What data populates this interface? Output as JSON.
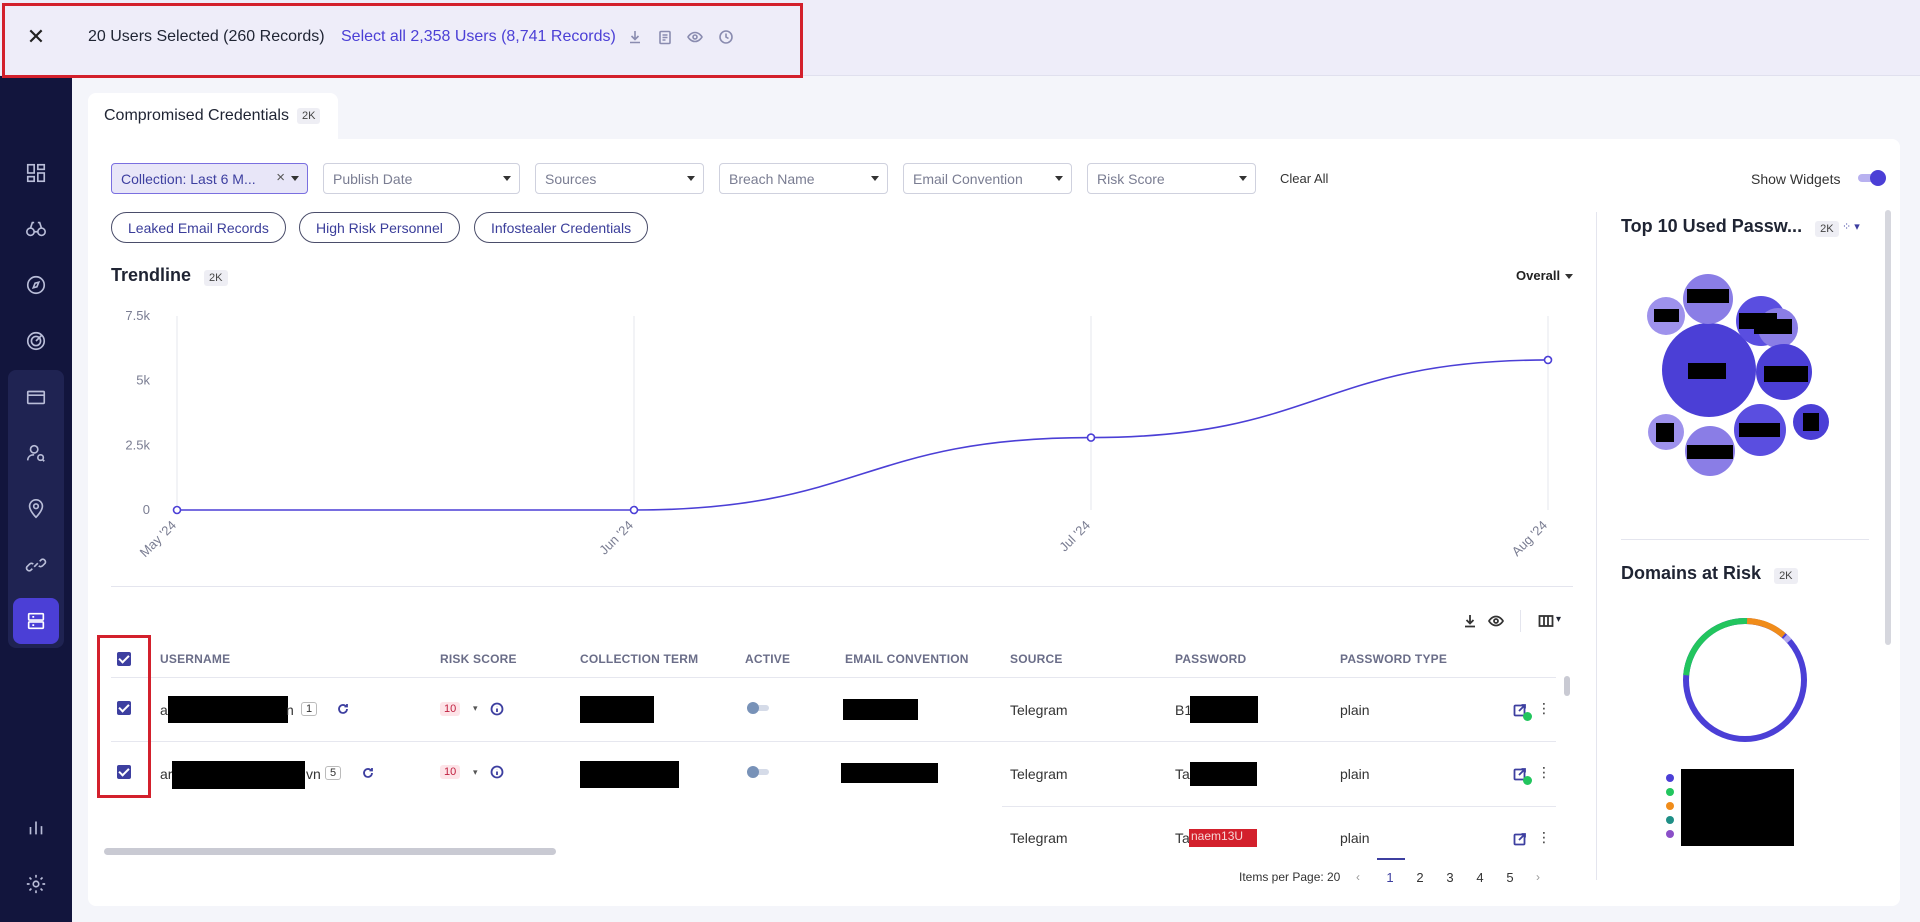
{
  "selection_bar": {
    "selected_text": "20 Users Selected (260 Records)",
    "select_all_text": "Select all 2,358 Users (8,741 Records)",
    "icons": [
      "download-icon",
      "clipboard-icon",
      "eye-icon",
      "clock-icon"
    ]
  },
  "sidebar": {
    "items": [
      "dashboard-icon",
      "binoculars-icon",
      "compass-icon",
      "radar-icon",
      "card-icon",
      "user-search-icon",
      "location-icon",
      "link-icon",
      "database-icon"
    ],
    "bottom": [
      "bar-chart-icon",
      "gear-icon"
    ]
  },
  "tab": {
    "label": "Compromised Credentials",
    "badge": "2K"
  },
  "filters": {
    "collection": "Collection: Last 6 M...",
    "publish_date": "Publish Date",
    "sources": "Sources",
    "breach_name": "Breach Name",
    "email_convention": "Email Convention",
    "risk_score": "Risk Score",
    "clear_all": "Clear All",
    "show_widgets": "Show Widgets"
  },
  "quick_filters": [
    "Leaked Email Records",
    "High Risk Personnel",
    "Infostealer Credentials"
  ],
  "trendline": {
    "title": "Trendline",
    "badge": "2K",
    "overall": "Overall"
  },
  "chart_data": {
    "type": "line",
    "title": "Trendline",
    "categories": [
      "May '24",
      "Jun '24",
      "Jul '24",
      "Aug '24"
    ],
    "values": [
      0,
      0,
      2800,
      5800
    ],
    "y_ticks": [
      "7.5k",
      "5k",
      "2.5k",
      "0"
    ],
    "ylim": [
      0,
      7500
    ],
    "grid": "vertical",
    "color": "#4b3fd6"
  },
  "top_passwords": {
    "title": "Top 10 Used Passw...",
    "badge": "2K"
  },
  "domains": {
    "title": "Domains at Risk",
    "badge": "2K"
  },
  "table": {
    "headers": [
      "USERNAME",
      "RISK SCORE",
      "COLLECTION TERM",
      "ACTIVE",
      "EMAIL CONVENTION",
      "SOURCE",
      "PASSWORD",
      "PASSWORD TYPE"
    ],
    "rows": [
      {
        "username_prefix": "a",
        "username_suffix": "n",
        "count": "1",
        "risk": "10",
        "source": "Telegram",
        "password_prefix": "B1",
        "password_type": "plain"
      },
      {
        "username_prefix": "ar",
        "username_suffix": "vn",
        "count": "5",
        "risk": "10",
        "source": "Telegram",
        "password_prefix": "Ta",
        "password_type": "plain"
      },
      {
        "source": "Telegram",
        "password_prefix": "Ta",
        "password_red": "naem13U",
        "password_type": "plain"
      }
    ]
  },
  "pagination": {
    "items_per_page_label": "Items per Page:",
    "items_per_page": "20",
    "pages": [
      "1",
      "2",
      "3",
      "4",
      "5"
    ]
  }
}
